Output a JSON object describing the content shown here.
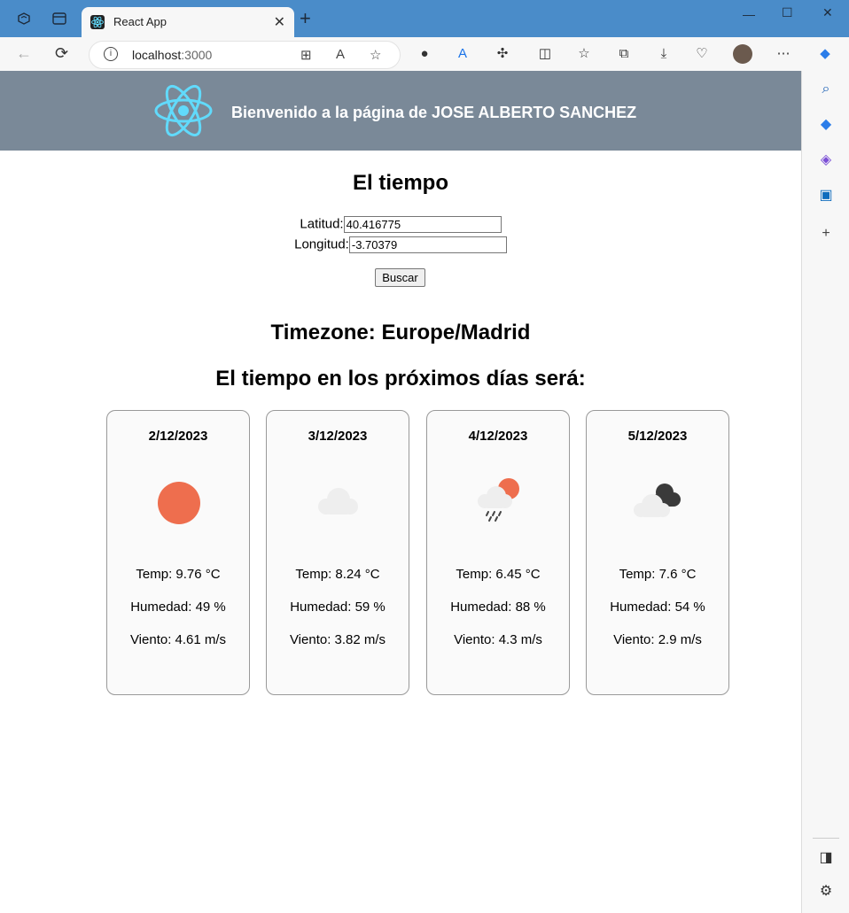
{
  "browser": {
    "tab_title": "React App",
    "url_host": "localhost",
    "url_port": ":3000"
  },
  "header": {
    "welcome": "Bienvenido a la página de JOSE ALBERTO SANCHEZ"
  },
  "weather": {
    "title": "El tiempo",
    "lat_label": "Latitud:",
    "lat_value": "40.416775",
    "lon_label": "Longitud:",
    "lon_value": "-3.70379",
    "search_label": "Buscar",
    "timezone_text": "Timezone: Europe/Madrid",
    "forecast_title": "El tiempo en los próximos días será:",
    "days": [
      {
        "date": "2/12/2023",
        "icon": "sun-icon",
        "temp": "Temp: 9.76 °C",
        "humidity": "Humedad: 49 %",
        "wind": "Viento: 4.61 m/s"
      },
      {
        "date": "3/12/2023",
        "icon": "cloud-icon",
        "temp": "Temp: 8.24 °C",
        "humidity": "Humedad: 59 %",
        "wind": "Viento: 3.82 m/s"
      },
      {
        "date": "4/12/2023",
        "icon": "rain-sun-icon",
        "temp": "Temp: 6.45 °C",
        "humidity": "Humedad: 88 %",
        "wind": "Viento: 4.3 m/s"
      },
      {
        "date": "5/12/2023",
        "icon": "dark-clouds-icon",
        "temp": "Temp: 7.6 °C",
        "humidity": "Humedad: 54 %",
        "wind": "Viento: 2.9 m/s"
      }
    ]
  },
  "colors": {
    "header_bg": "#7a8998",
    "sun": "#ee6e4e",
    "cloud_light": "#eeeeee",
    "cloud_dark": "#3a3a3a",
    "react_blue": "#61dafb"
  }
}
